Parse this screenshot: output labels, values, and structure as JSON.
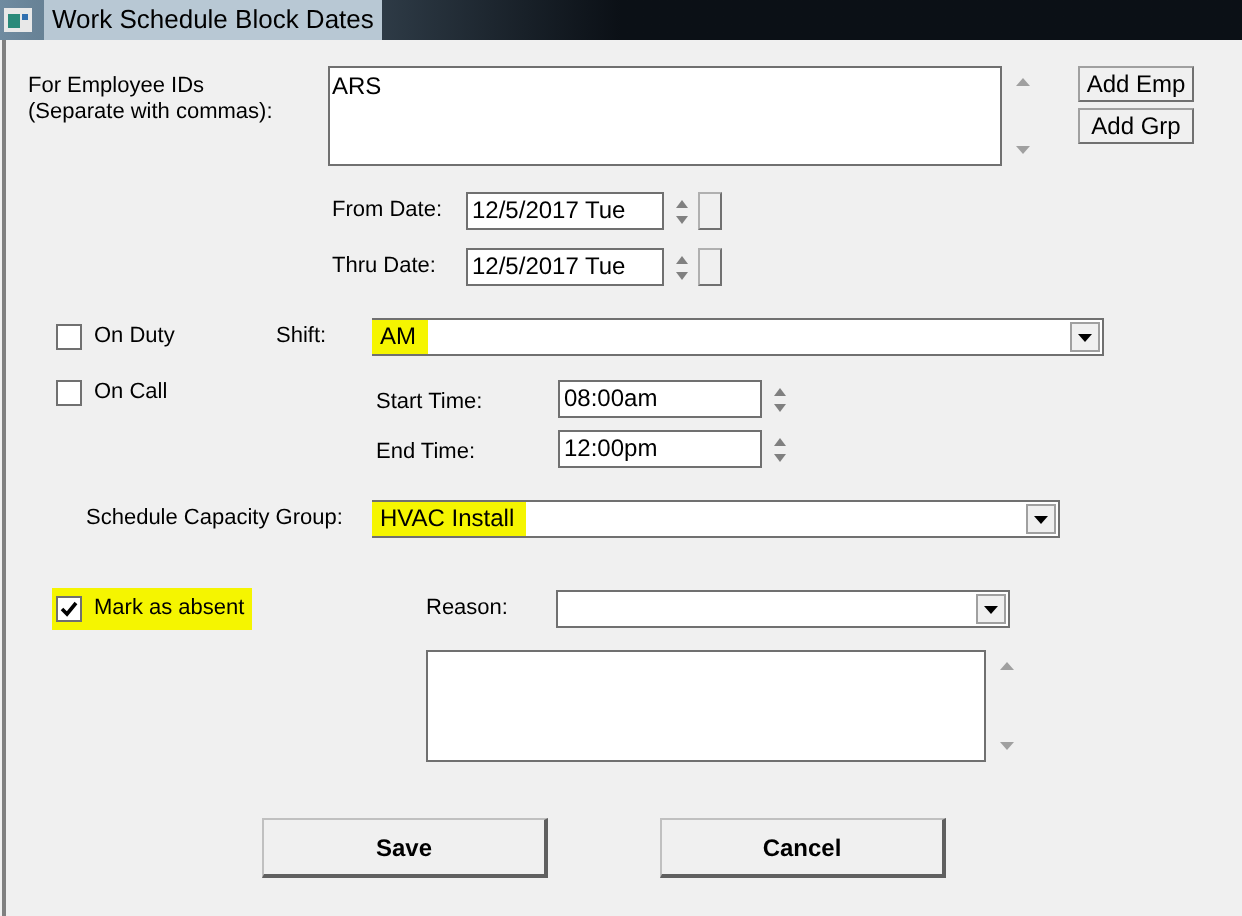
{
  "window": {
    "title": "Work Schedule Block Dates"
  },
  "employees": {
    "label_lines": [
      "For Employee IDs",
      "(Separate with commas):"
    ],
    "value": "ARS"
  },
  "employee_buttons": [
    "Add Emp",
    "Add Grp"
  ],
  "dates": [
    {
      "label": "From Date:",
      "value": "12/5/2017 Tue"
    },
    {
      "label": "Thru Date:",
      "value": "12/5/2017 Tue"
    }
  ],
  "on_duty": {
    "label": "On Duty",
    "checked": false
  },
  "shift": {
    "label": "Shift:",
    "value": "AM",
    "highlighted": true
  },
  "on_call": {
    "label": "On Call",
    "checked": false
  },
  "times": [
    {
      "label": "Start Time:",
      "value": "08:00am"
    },
    {
      "label": "End Time:",
      "value": "12:00pm"
    }
  ],
  "capacity_group": {
    "label": "Schedule Capacity Group:",
    "value": "HVAC Install",
    "highlighted": true
  },
  "mark_absent": {
    "label": "Mark as absent",
    "checked": true,
    "highlighted": true
  },
  "reason": {
    "label": "Reason:"
  },
  "buttons": [
    "Save",
    "Cancel"
  ]
}
